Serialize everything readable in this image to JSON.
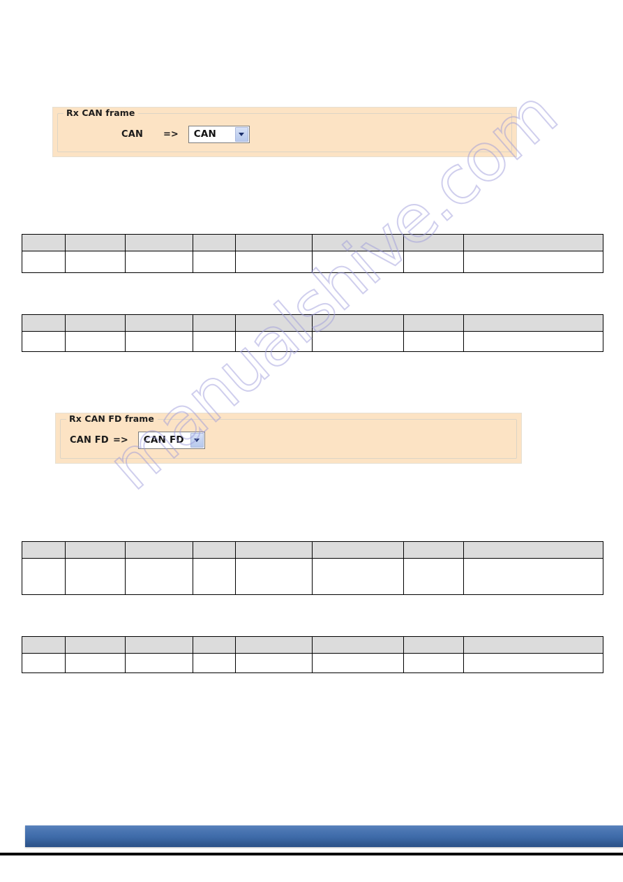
{
  "document": {
    "page_background": "#ffffff",
    "watermark_text": "manualshive.com",
    "watermark_color": "#9c9ada"
  },
  "panels": [
    {
      "legend": "Rx CAN frame",
      "background_color": "#fce3c4",
      "field": {
        "label": "CAN",
        "arrow": "=>",
        "dropdown_value": "CAN",
        "dropdown_icon": "chevron-down-icon"
      }
    },
    {
      "legend": "Rx CAN FD frame",
      "background_color": "#fce3c4",
      "field": {
        "label": "CAN FD",
        "arrow": "=>",
        "dropdown_value": "CAN FD",
        "dropdown_icon": "chevron-down-icon"
      }
    }
  ],
  "tables": [
    {
      "header_color": "#dcdcdc",
      "header_cells": [
        "",
        "",
        "",
        "",
        "",
        "",
        "",
        ""
      ],
      "body_rows": [
        [
          "",
          "",
          "",
          "",
          "",
          "",
          "",
          ""
        ]
      ]
    },
    {
      "header_color": "#dcdcdc",
      "header_cells": [
        "",
        "",
        "",
        "",
        "",
        "",
        "",
        ""
      ],
      "body_rows": [
        [
          "",
          "",
          "",
          "",
          "",
          "",
          "",
          ""
        ]
      ]
    },
    {
      "header_color": "#dcdcdc",
      "header_cells": [
        "",
        "",
        "",
        "",
        "",
        "",
        "",
        ""
      ],
      "body_rows": [
        [
          "",
          "",
          "",
          "",
          "",
          "",
          "",
          ""
        ]
      ]
    },
    {
      "header_color": "#dcdcdc",
      "header_cells": [
        "",
        "",
        "",
        "",
        "",
        "",
        "",
        ""
      ],
      "body_rows": [
        [
          "",
          "",
          "",
          "",
          "",
          "",
          "",
          ""
        ]
      ]
    }
  ],
  "footer": {
    "bar_color": "#3d6aa8",
    "rule_color": "#000000"
  }
}
